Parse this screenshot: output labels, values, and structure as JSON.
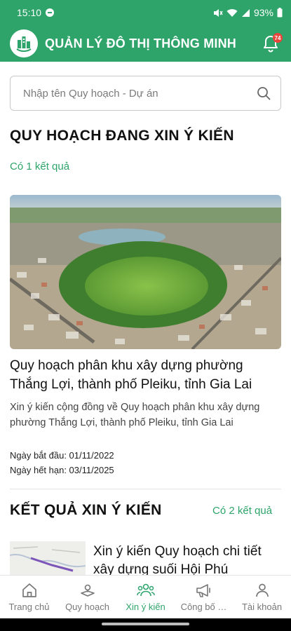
{
  "status_bar": {
    "time": "15:10",
    "battery": "93%"
  },
  "header": {
    "title": "QUẢN LÝ ĐÔ THỊ THÔNG MINH",
    "notification_count": "74"
  },
  "search": {
    "placeholder": "Nhập tên Quy hoạch - Dự án"
  },
  "consultation": {
    "title": "QUY HOẠCH ĐANG XIN Ý KIẾN",
    "count": "Có 1 kết quả",
    "card": {
      "title": "Quy hoạch phân khu xây dựng phường Thắng Lợi, thành phố Pleiku, tỉnh Gia Lai",
      "description": "Xin ý kiến cộng đồng về Quy hoạch phân khu xây dựng phường Thắng Lợi, thành phố Pleiku, tỉnh Gia Lai",
      "start_date": "Ngày bắt đầu: 01/11/2022",
      "end_date": "Ngày hết hạn: 03/11/2025"
    }
  },
  "results": {
    "title": "KẾT QUẢ XIN Ý KIẾN",
    "count": "Có 2 kết quả",
    "items": [
      {
        "title": "Xin ý kiến Quy hoạch chi tiết xây dựng suối Hội Phú"
      }
    ]
  },
  "bottom_nav": {
    "items": [
      {
        "label": "Trang chủ",
        "icon": "home-icon"
      },
      {
        "label": "Quy hoạch",
        "icon": "map-layers-icon"
      },
      {
        "label": "Xin ý kiến",
        "icon": "people-icon"
      },
      {
        "label": "Công bố …",
        "icon": "megaphone-icon"
      },
      {
        "label": "Tài khoản",
        "icon": "user-icon"
      }
    ],
    "active_index": 2
  },
  "colors": {
    "primary": "#2ea46a",
    "badge": "#e8453c"
  }
}
